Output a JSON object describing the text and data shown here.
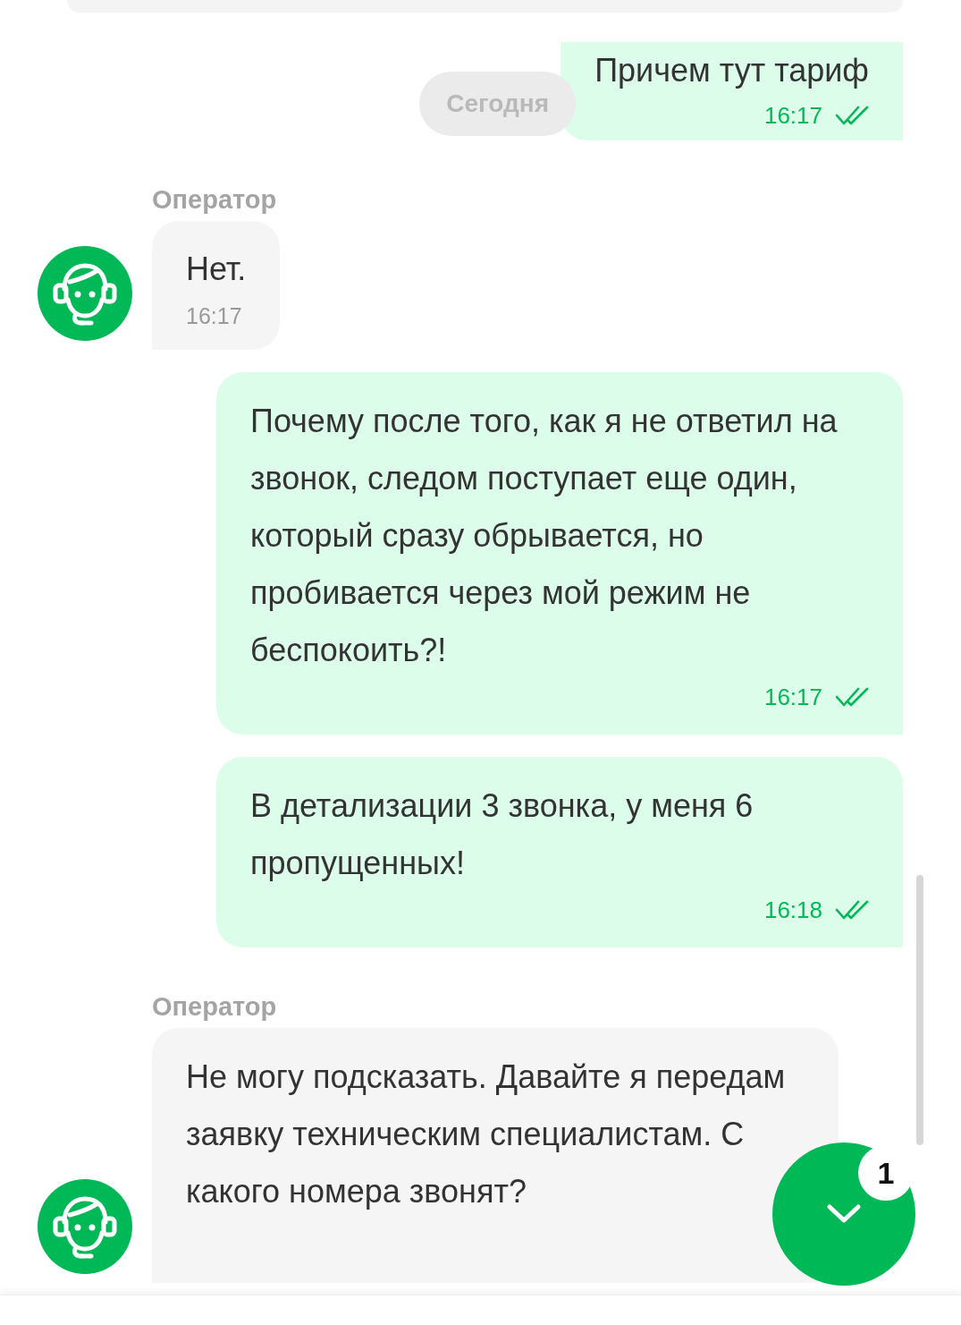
{
  "date_divider": {
    "text": "Сегодня"
  },
  "messages": [
    {
      "kind": "outgoing",
      "text": "Причем тут тариф",
      "time": "16:17",
      "read": true
    },
    {
      "kind": "incoming",
      "author": "Оператор",
      "text": "Нет.",
      "time": "16:17"
    },
    {
      "kind": "outgoing",
      "text": "Почему после того, как я не ответил на звонок, следом поступает еще один, который сразу обрывается, но пробивается через мой режим не беспокоить?!",
      "time": "16:17",
      "read": true
    },
    {
      "kind": "outgoing",
      "text": "В детализации 3 звонка, у меня 6 пропущенных!",
      "time": "16:18",
      "read": true
    },
    {
      "kind": "incoming",
      "author": "Оператор",
      "text": "Не могу подсказать. Давайте я передам заявку техническим специалистам. С какого номера звонят?"
    }
  ],
  "scroll_down_button": {
    "badge": "1"
  }
}
